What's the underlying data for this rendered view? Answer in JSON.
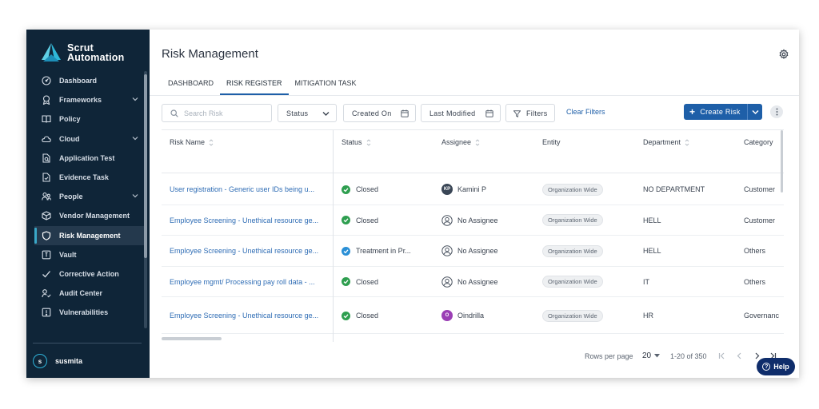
{
  "app": {
    "brand_line1": "Scrut",
    "brand_line2": "Automation"
  },
  "sidebar": {
    "items": [
      {
        "label": "Dashboard",
        "icon": "dashboard-icon"
      },
      {
        "label": "Frameworks",
        "icon": "award-icon",
        "has_chevron": true
      },
      {
        "label": "Policy",
        "icon": "book-icon"
      },
      {
        "label": "Cloud",
        "icon": "cloud-icon",
        "has_chevron": true
      },
      {
        "label": "Application Test",
        "icon": "app-test-icon"
      },
      {
        "label": "Evidence Task",
        "icon": "evidence-icon"
      },
      {
        "label": "People",
        "icon": "people-icon",
        "has_chevron": true
      },
      {
        "label": "Vendor Management",
        "icon": "vendor-icon"
      },
      {
        "label": "Risk Management",
        "icon": "shield-icon",
        "active": true
      },
      {
        "label": "Vault",
        "icon": "vault-icon"
      },
      {
        "label": "Corrective Action",
        "icon": "check-icon"
      },
      {
        "label": "Audit Center",
        "icon": "audit-icon"
      },
      {
        "label": "Vulnerabilities",
        "icon": "vulnerability-icon"
      }
    ],
    "user": {
      "initial": "s",
      "name": "susmita"
    }
  },
  "header": {
    "title": "Risk Management"
  },
  "tabs": [
    {
      "label": "DASHBOARD",
      "active": false
    },
    {
      "label": "RISK REGISTER",
      "active": true
    },
    {
      "label": "MITIGATION TASK",
      "active": false
    }
  ],
  "toolbar": {
    "search_placeholder": "Search Risk",
    "status_label": "Status",
    "created_on_label": "Created On",
    "last_modified_label": "Last Modified",
    "filters_label": "Filters",
    "clear_filters_label": "Clear Filters",
    "create_label": "Create Risk"
  },
  "table": {
    "columns": [
      "Risk Name",
      "Status",
      "Assignee",
      "Entity",
      "Department",
      "Category"
    ],
    "rows": [
      {
        "risk_name": "User registration - Generic user IDs being u...",
        "status": "Closed",
        "status_type": "closed",
        "assignee": "Kamini P",
        "assignee_initials": "KP",
        "assignee_type": "initials",
        "avatar_color": "#3a4656",
        "entity": "Organization Wide",
        "department": "NO DEPARTMENT",
        "category": "Customer"
      },
      {
        "risk_name": "Employee Screening - Unethical resource ge...",
        "status": "Closed",
        "status_type": "closed",
        "assignee": "No Assignee",
        "assignee_initials": "",
        "assignee_type": "none",
        "avatar_color": "",
        "entity": "Organization Wide",
        "department": "HELL",
        "category": "Customer"
      },
      {
        "risk_name": "Employee Screening - Unethical resource ge...",
        "status": "Treatment in Pr...",
        "status_type": "treatment",
        "assignee": "No Assignee",
        "assignee_initials": "",
        "assignee_type": "none",
        "avatar_color": "",
        "entity": "Organization Wide",
        "department": "HELL",
        "category": "Others"
      },
      {
        "risk_name": "Employee mgmt/ Processing pay roll data - ...",
        "status": "Closed",
        "status_type": "closed",
        "assignee": "No Assignee",
        "assignee_initials": "",
        "assignee_type": "none",
        "avatar_color": "",
        "entity": "Organization Wide",
        "department": "IT",
        "category": "Others"
      },
      {
        "risk_name": "Employee Screening - Unethical resource ge...",
        "status": "Closed",
        "status_type": "closed",
        "assignee": "Oindrilla",
        "assignee_initials": "O",
        "assignee_type": "initials",
        "avatar_color": "#9b3fb5",
        "entity": "Organization Wide",
        "department": "HR",
        "category": "Governanc"
      }
    ]
  },
  "footer": {
    "rows_per_page_label": "Rows per page",
    "rows_per_page_value": "20",
    "range": "1-20 of 350"
  },
  "help": {
    "label": "Help"
  },
  "colors": {
    "sidebar_bg": "#0f2538",
    "accent": "#1e5fa8",
    "status_closed": "#2e9e4f",
    "status_treatment": "#2a8fd6",
    "help_bg": "#0f2d6b"
  }
}
